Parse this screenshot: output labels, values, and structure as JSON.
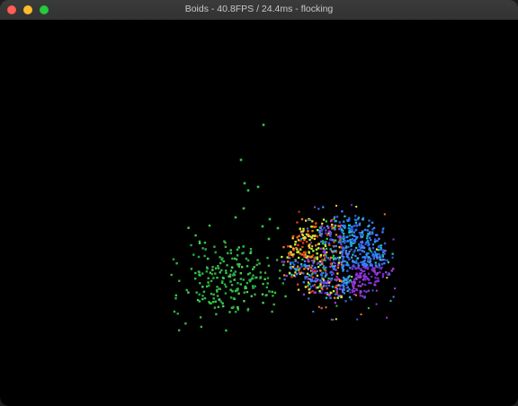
{
  "window": {
    "title": "Boids - 40.8FPS / 24.4ms - flocking"
  },
  "colors": {
    "background": "#000000",
    "titlebar": "#353535",
    "title_text": "#c9c9c9",
    "close": "#fe5f57",
    "minimize": "#febc2e",
    "maximize": "#28c840"
  },
  "simulation": {
    "palette": [
      "#2ecc40",
      "#3f8f3a",
      "#1e90ff",
      "#3b5bdb",
      "#7b2fd0",
      "#b03fd6",
      "#ff7a1a",
      "#e0401a",
      "#f4d03f",
      "#c0ff3a",
      "#20c0c0"
    ]
  }
}
